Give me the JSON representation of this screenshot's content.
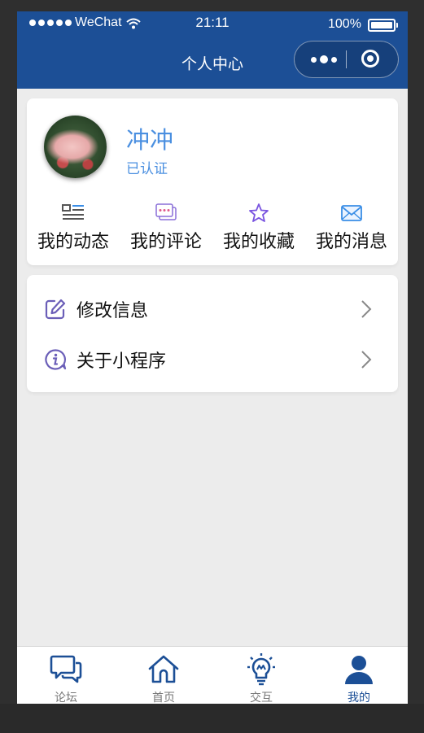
{
  "status_bar": {
    "carrier": "WeChat",
    "time": "21:11",
    "battery": "100%"
  },
  "nav": {
    "title": "个人中心"
  },
  "profile": {
    "name": "冲冲",
    "status": "已认证"
  },
  "shortcuts": [
    {
      "label": "我的动态",
      "icon": "news-list-icon"
    },
    {
      "label": "我的评论",
      "icon": "comment-bubbles-icon"
    },
    {
      "label": "我的收藏",
      "icon": "star-icon"
    },
    {
      "label": "我的消息",
      "icon": "envelope-icon"
    }
  ],
  "menu": [
    {
      "label": "修改信息",
      "icon": "edit-icon"
    },
    {
      "label": "关于小程序",
      "icon": "info-icon"
    }
  ],
  "tabbar": {
    "active_index": 3,
    "active_color": "#1c4f96",
    "items": [
      {
        "label": "论坛",
        "icon": "chat-bubbles-icon"
      },
      {
        "label": "首页",
        "icon": "home-icon"
      },
      {
        "label": "交互",
        "icon": "lightbulb-icon"
      },
      {
        "label": "我的",
        "icon": "user-icon"
      }
    ]
  },
  "colors": {
    "primary": "#1c4f96",
    "accent_text": "#4a8fe0",
    "background": "#ececec"
  }
}
